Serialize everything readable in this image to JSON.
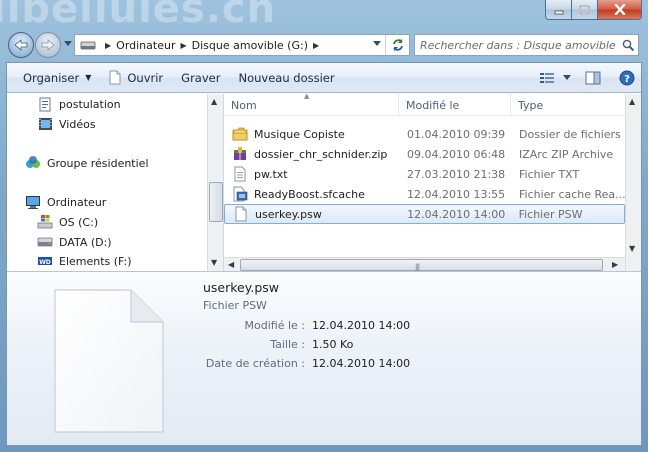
{
  "window": {
    "title_watermark": "libellules.ch"
  },
  "address": {
    "segments": [
      "Ordinateur",
      "Disque amovible (G:)"
    ]
  },
  "search": {
    "placeholder": "Rechercher dans : Disque amovible (G:)"
  },
  "toolbar": {
    "organize": "Organiser",
    "open": "Ouvrir",
    "burn": "Graver",
    "new_folder": "Nouveau dossier"
  },
  "nav": {
    "items": [
      {
        "label": "postulation",
        "icon": "document-icon"
      },
      {
        "label": "Vidéos",
        "icon": "video-icon"
      },
      {
        "label": "Groupe résidentiel",
        "icon": "homegroup-icon"
      },
      {
        "label": "Ordinateur",
        "icon": "computer-icon"
      },
      {
        "label": "OS (C:)",
        "icon": "windows-drive-icon"
      },
      {
        "label": "DATA (D:)",
        "icon": "drive-icon"
      },
      {
        "label": "Elements (F:)",
        "icon": "wd-drive-icon"
      }
    ]
  },
  "columns": {
    "name": "Nom",
    "date": "Modifié le",
    "type": "Type"
  },
  "files": [
    {
      "name": "Musique Copiste",
      "date": "01.04.2010 09:39",
      "type": "Dossier de fichiers",
      "icon": "folder-icon"
    },
    {
      "name": "dossier_chr_schnider.zip",
      "date": "09.04.2010 06:48",
      "type": "IZArc ZIP Archive",
      "icon": "zip-archive-icon"
    },
    {
      "name": "pw.txt",
      "date": "27.03.2010 21:38",
      "type": "Fichier TXT",
      "icon": "text-file-icon"
    },
    {
      "name": "ReadyBoost.sfcache",
      "date": "12.04.2010 13:55",
      "type": "Fichier cache Rea...",
      "icon": "readyboost-file-icon"
    },
    {
      "name": "userkey.psw",
      "date": "12.04.2010 14:00",
      "type": "Fichier PSW",
      "icon": "blank-file-icon",
      "selected": true
    }
  ],
  "details": {
    "name": "userkey.psw",
    "type": "Fichier PSW",
    "modified_label": "Modifié le :",
    "modified_value": "12.04.2010 14:00",
    "size_label": "Taille :",
    "size_value": "1.50 Ko",
    "created_label": "Date de création :",
    "created_value": "12.04.2010 14:00"
  },
  "colors": {
    "frame": "#7fa9cc",
    "selection_border": "#84acdd",
    "close_button": "#c03a1f"
  }
}
